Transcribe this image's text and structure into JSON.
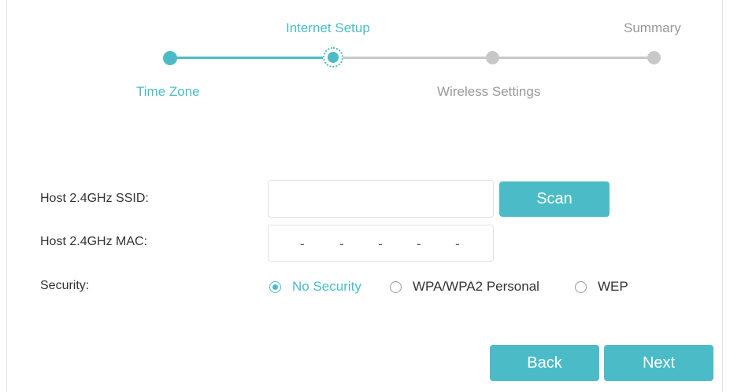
{
  "stepper": {
    "steps": [
      {
        "label": "Time Zone",
        "state": "completed"
      },
      {
        "label": "Internet Setup",
        "state": "current"
      },
      {
        "label": "Wireless Settings",
        "state": "pending"
      },
      {
        "label": "Summary",
        "state": "pending"
      }
    ]
  },
  "form": {
    "ssid": {
      "label": "Host 2.4GHz SSID:",
      "value": "",
      "placeholder": ""
    },
    "scan_button": "Scan",
    "mac": {
      "label": "Host 2.4GHz MAC:",
      "segments": [
        "-",
        "-",
        "-",
        "-",
        "-"
      ]
    },
    "security": {
      "label": "Security:",
      "options": [
        "No Security",
        "WPA/WPA2 Personal",
        "WEP"
      ],
      "selected": "No Security"
    }
  },
  "footer": {
    "back_label": "Back",
    "next_label": "Next"
  },
  "colors": {
    "accent": "#4bbcc7",
    "inactive": "#c8c8c8",
    "text": "#333333",
    "muted_text": "#999999"
  }
}
